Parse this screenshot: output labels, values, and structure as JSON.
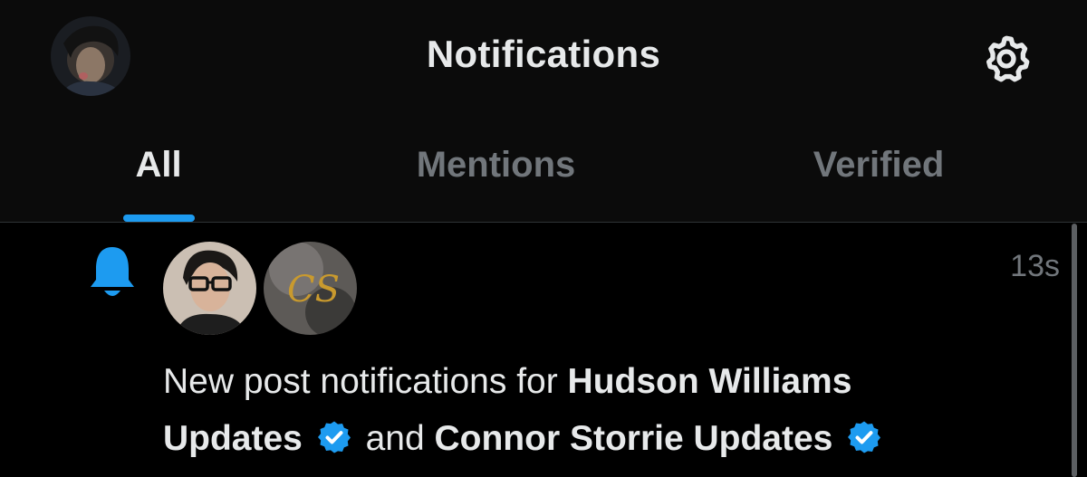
{
  "header": {
    "title": "Notifications"
  },
  "tabs": [
    {
      "label": "All",
      "active": true
    },
    {
      "label": "Mentions",
      "active": false
    },
    {
      "label": "Verified",
      "active": false
    }
  ],
  "notification": {
    "time": "13s",
    "text_prefix": "New post notifications for ",
    "account_1": "Hudson Williams Updates",
    "connector": "and",
    "account_2": "Connor Storrie Updates"
  },
  "icons": {
    "settings": "gear-icon",
    "notification_type": "bell-icon",
    "verified": "verified-badge-icon"
  },
  "colors": {
    "accent": "#1d9bf0",
    "background": "#000000",
    "header_background": "#0b0b0b",
    "muted_text": "#71767b",
    "primary_text": "#e7e9ea"
  }
}
